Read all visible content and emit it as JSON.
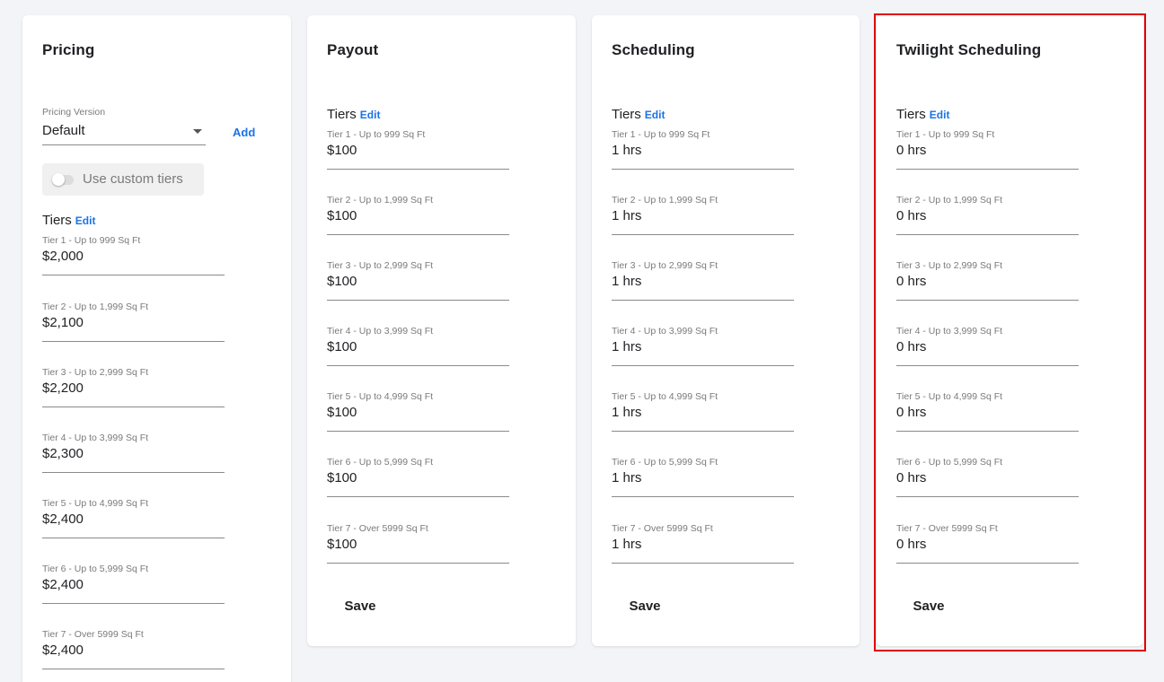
{
  "pricing": {
    "title": "Pricing",
    "version_label": "Pricing Version",
    "version_value": "Default",
    "add_label": "Add",
    "custom_tiers_label": "Use custom tiers",
    "custom_tiers_enabled": false,
    "tiers_heading": "Tiers",
    "edit_label": "Edit",
    "tiers": [
      {
        "label": "Tier 1 - Up to 999 Sq Ft",
        "value": "$2,000"
      },
      {
        "label": "Tier 2 - Up to 1,999 Sq Ft",
        "value": "$2,100"
      },
      {
        "label": "Tier 3 - Up to 2,999 Sq Ft",
        "value": "$2,200"
      },
      {
        "label": "Tier 4 - Up to 3,999 Sq Ft",
        "value": "$2,300"
      },
      {
        "label": "Tier 5 - Up to 4,999 Sq Ft",
        "value": "$2,400"
      },
      {
        "label": "Tier 6 - Up to 5,999 Sq Ft",
        "value": "$2,400"
      },
      {
        "label": "Tier 7 - Over 5999 Sq Ft",
        "value": "$2,400"
      }
    ]
  },
  "payout": {
    "title": "Payout",
    "tiers_heading": "Tiers",
    "edit_label": "Edit",
    "save_label": "Save",
    "tiers": [
      {
        "label": "Tier 1 - Up to 999 Sq Ft",
        "value": "$100"
      },
      {
        "label": "Tier 2 - Up to 1,999 Sq Ft",
        "value": "$100"
      },
      {
        "label": "Tier 3 - Up to 2,999 Sq Ft",
        "value": "$100"
      },
      {
        "label": "Tier 4 - Up to 3,999 Sq Ft",
        "value": "$100"
      },
      {
        "label": "Tier 5 - Up to 4,999 Sq Ft",
        "value": "$100"
      },
      {
        "label": "Tier 6 - Up to 5,999 Sq Ft",
        "value": "$100"
      },
      {
        "label": "Tier 7 - Over 5999 Sq Ft",
        "value": "$100"
      }
    ]
  },
  "scheduling": {
    "title": "Scheduling",
    "tiers_heading": "Tiers",
    "edit_label": "Edit",
    "save_label": "Save",
    "tiers": [
      {
        "label": "Tier 1 - Up to 999 Sq Ft",
        "value": "1 hrs"
      },
      {
        "label": "Tier 2 - Up to 1,999 Sq Ft",
        "value": "1 hrs"
      },
      {
        "label": "Tier 3 - Up to 2,999 Sq Ft",
        "value": "1 hrs"
      },
      {
        "label": "Tier 4 - Up to 3,999 Sq Ft",
        "value": "1 hrs"
      },
      {
        "label": "Tier 5 - Up to 4,999 Sq Ft",
        "value": "1 hrs"
      },
      {
        "label": "Tier 6 - Up to 5,999 Sq Ft",
        "value": "1 hrs"
      },
      {
        "label": "Tier 7 - Over 5999 Sq Ft",
        "value": "1 hrs"
      }
    ]
  },
  "twilight": {
    "title": "Twilight Scheduling",
    "tiers_heading": "Tiers",
    "edit_label": "Edit",
    "save_label": "Save",
    "tiers": [
      {
        "label": "Tier 1 - Up to 999 Sq Ft",
        "value": "0 hrs"
      },
      {
        "label": "Tier 2 - Up to 1,999 Sq Ft",
        "value": "0 hrs"
      },
      {
        "label": "Tier 3 - Up to 2,999 Sq Ft",
        "value": "0 hrs"
      },
      {
        "label": "Tier 4 - Up to 3,999 Sq Ft",
        "value": "0 hrs"
      },
      {
        "label": "Tier 5 - Up to 4,999 Sq Ft",
        "value": "0 hrs"
      },
      {
        "label": "Tier 6 - Up to 5,999 Sq Ft",
        "value": "0 hrs"
      },
      {
        "label": "Tier 7 - Over 5999 Sq Ft",
        "value": "0 hrs"
      }
    ]
  },
  "colors": {
    "accent": "#1a73e8",
    "highlight": "#e00000",
    "background": "#f3f4f8"
  }
}
